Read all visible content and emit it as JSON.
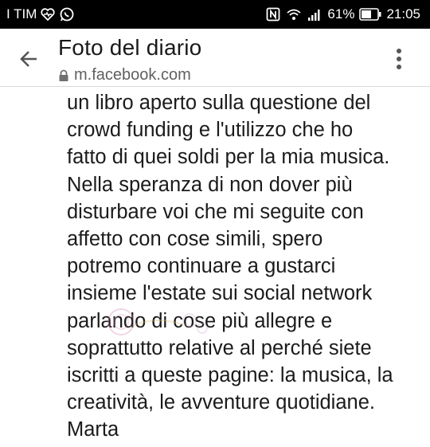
{
  "status_bar": {
    "carrier": "I TIM",
    "battery_percent": "61%",
    "time": "21:05"
  },
  "header": {
    "title": "Foto del diario",
    "url": "m.facebook.com"
  },
  "post": {
    "lines": [
      "un libro aperto sulla questione del",
      "crowd funding e l'utilizzo che ho",
      "fatto di quei soldi per la mia musica.",
      "Nella speranza di non dover più",
      "disturbare voi che mi seguite con",
      "affetto con cose simili, spero",
      "potremo continuare a gustarci",
      "insieme l'estate sui social network",
      "parlando di cose più allegre e",
      "soprattutto relative al perché siete",
      "iscritti a queste pagine: la musica, la",
      "creatività, le avventure quotidiane.",
      "Marta"
    ]
  }
}
